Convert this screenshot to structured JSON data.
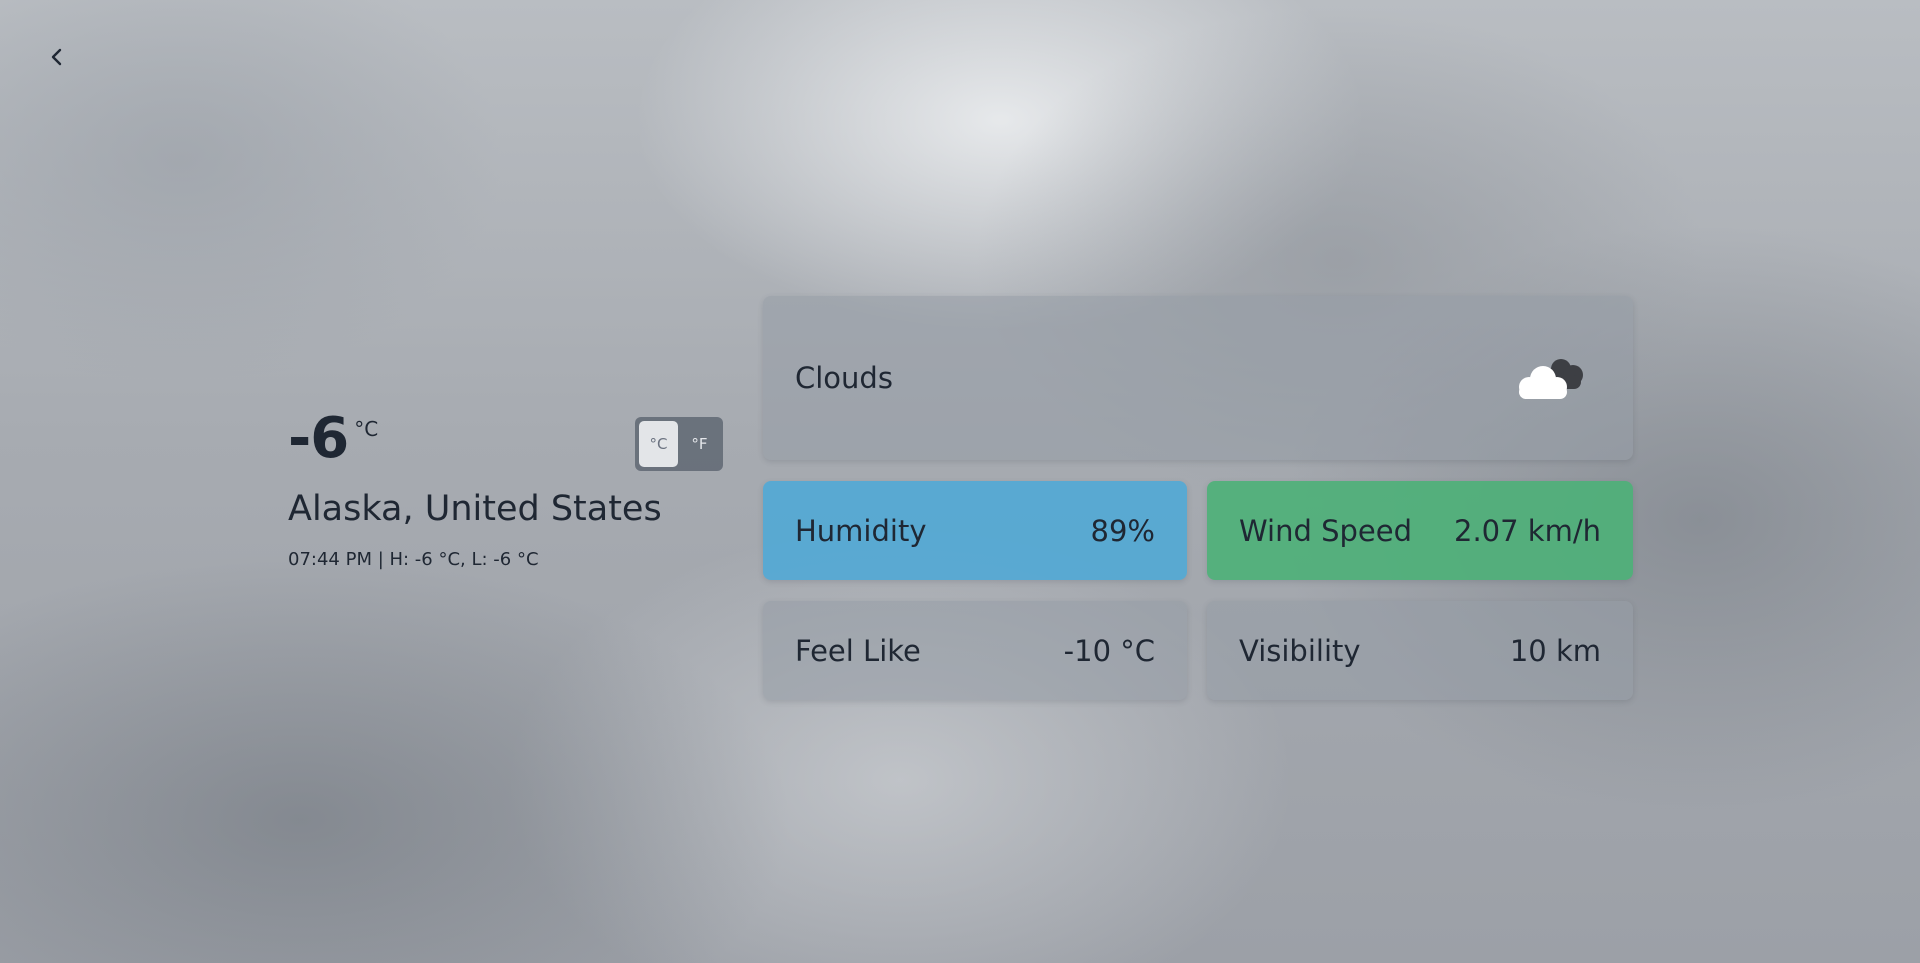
{
  "nav": {
    "back_icon": "chevron-left-icon"
  },
  "current": {
    "temperature": "-6",
    "unit_symbol": "°C",
    "location": "Alaska, United States",
    "meta": "07:44 PM | H: -6 °C, L: -6 °C"
  },
  "unit_toggle": {
    "celsius_label": "°C",
    "fahrenheit_label": "°F",
    "selected": "°C"
  },
  "condition": {
    "label": "Clouds",
    "icon": "clouds-icon"
  },
  "stats": {
    "humidity": {
      "label": "Humidity",
      "value": "89%",
      "color": "#4ea8d6"
    },
    "wind": {
      "label": "Wind Speed",
      "value": "2.07 km/h",
      "color": "#4cb078"
    },
    "feels_like": {
      "label": "Feel Like",
      "value": "-10 °C"
    },
    "visibility": {
      "label": "Visibility",
      "value": "10 km"
    }
  }
}
